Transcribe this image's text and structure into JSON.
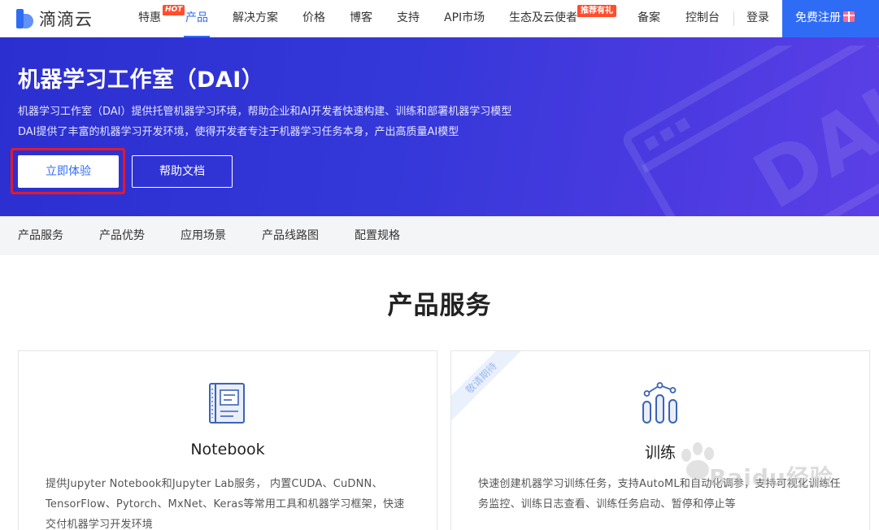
{
  "brand": {
    "name": "滴滴云",
    "color": "#2f6cf6"
  },
  "nav": {
    "items": [
      {
        "label": "特惠",
        "badge": "HOT"
      },
      {
        "label": "产品",
        "active": true
      },
      {
        "label": "解决方案"
      },
      {
        "label": "价格"
      },
      {
        "label": "博客"
      },
      {
        "label": "支持"
      },
      {
        "label": "API市场"
      },
      {
        "label": "生态及云使者",
        "badge": "推荐有礼"
      },
      {
        "label": "备案"
      },
      {
        "label": "控制台"
      }
    ],
    "login": "登录",
    "register": "免费注册"
  },
  "banner": {
    "title": "机器学习工作室（DAI）",
    "line1": "机器学习工作室（DAI）提供托管机器学习环境，帮助企业和AI开发者快速构建、训练和部署机器学习模型",
    "line2": "DAI提供了丰富的机器学习开发环境，使得开发者专注于机器学习任务本身，产出高质量AI模型",
    "primary_button": "立即体验",
    "secondary_button": "帮助文档",
    "deco_text": "DAI"
  },
  "subtabs": [
    "产品服务",
    "产品优势",
    "应用场景",
    "产品线路图",
    "配置规格"
  ],
  "section": {
    "title": "产品服务",
    "cards": [
      {
        "icon": "notebook-icon",
        "title": "Notebook",
        "desc": "提供Jupyter Notebook和Jupyter Lab服务， 内置CUDA、CuDNN、TensorFlow、Pytorch、MxNet、Keras等常用工具和机器学习框架，快速交付机器学习开发环境"
      },
      {
        "icon": "training-chart-icon",
        "ribbon": "敬请期待",
        "title": "训练",
        "desc": "快速创建机器学习训练任务，支持AutoML和自动化调参，支持可视化训练任务监控、训练日志查看、训练任务启动、暂停和停止等"
      }
    ]
  },
  "watermark": {
    "text": "Baidu经验"
  }
}
